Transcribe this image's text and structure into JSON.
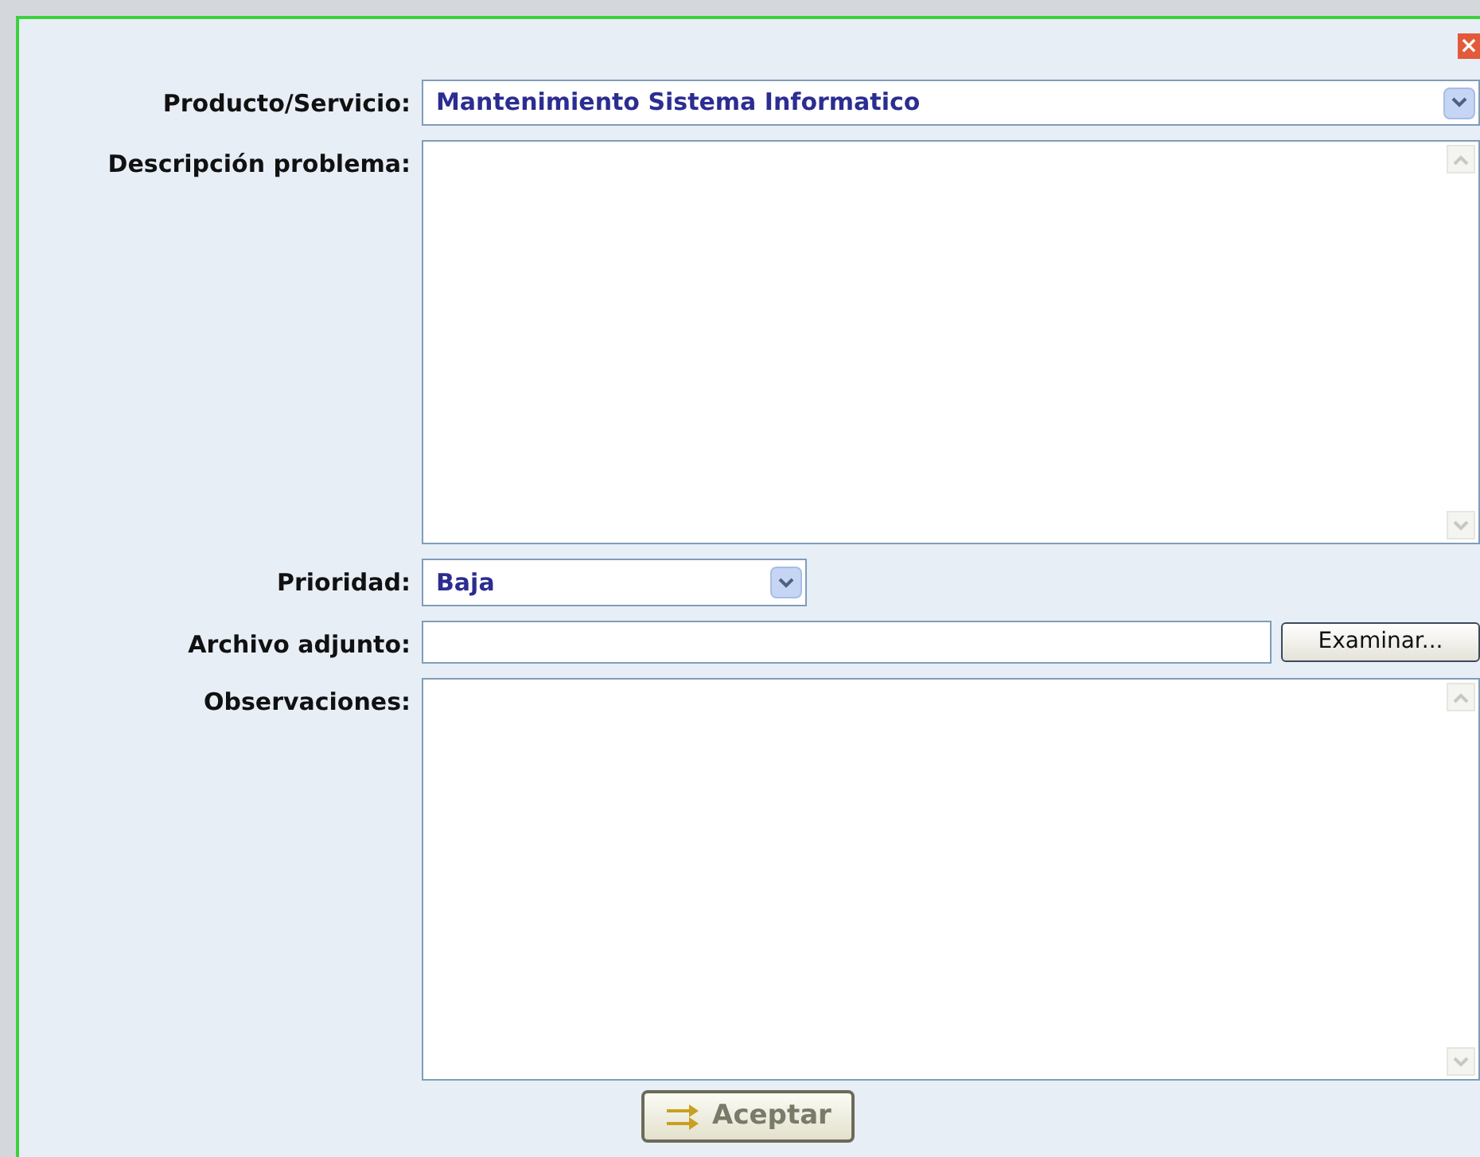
{
  "close": "×",
  "fields": [
    {
      "kind": "select",
      "label": "Producto/Servicio:",
      "value": "Mantenimiento Sistema Informatico"
    },
    {
      "kind": "textarea",
      "label": "Descripción problema:"
    },
    {
      "kind": "shortselect",
      "label": "Prioridad:",
      "value": "Baja"
    },
    {
      "kind": "file",
      "label": "Archivo adjunto:",
      "button": "Examinar..."
    },
    {
      "kind": "textarea",
      "label": "Observaciones:"
    }
  ],
  "submit": "Aceptar"
}
